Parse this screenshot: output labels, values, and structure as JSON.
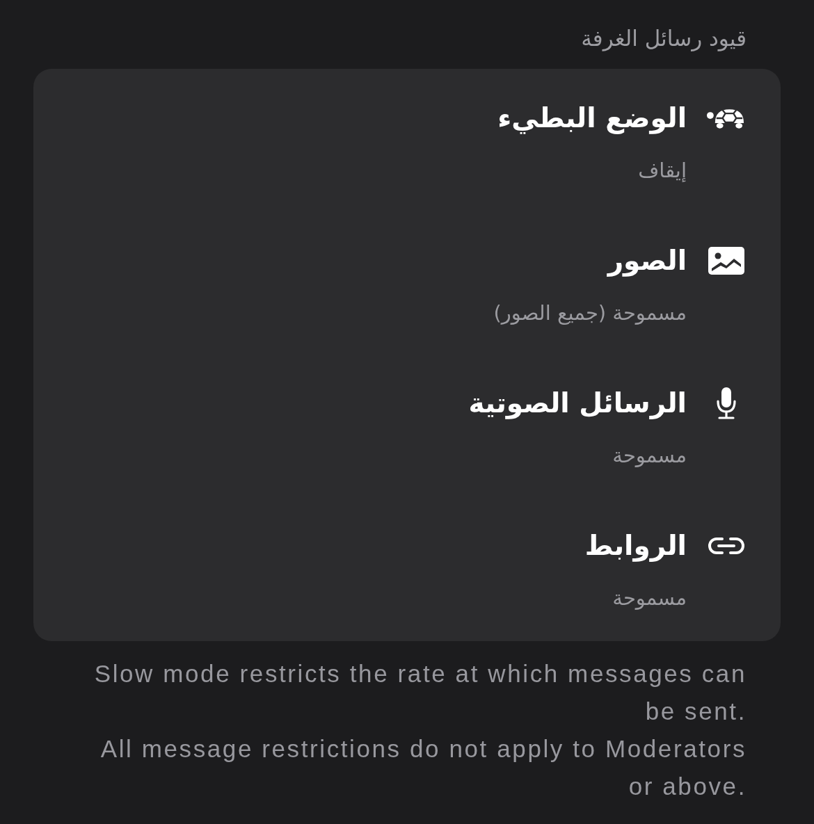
{
  "section_header": "قيود رسائل الغرفة",
  "settings": [
    {
      "kind": "slowmode",
      "title": "الوضع البطيء",
      "value": "إيقاف"
    },
    {
      "kind": "photos",
      "title": "الصور",
      "value": "مسموحة (جميع الصور)"
    },
    {
      "kind": "voice",
      "title": "الرسائل الصوتية",
      "value": "مسموحة"
    },
    {
      "kind": "links",
      "title": "الروابط",
      "value": "مسموحة"
    }
  ],
  "footer": [
    "Slow mode restricts the rate at which messages can be sent.",
    "All message restrictions do not apply to Moderators or above."
  ]
}
